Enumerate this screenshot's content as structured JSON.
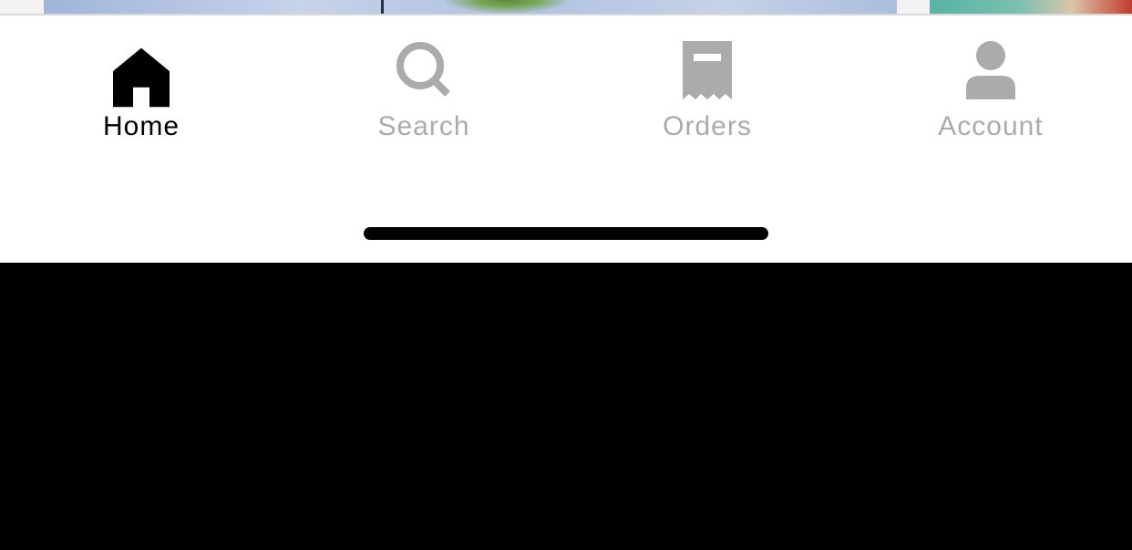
{
  "tab_bar": {
    "active": "home",
    "items": [
      {
        "id": "home",
        "label": "Home",
        "icon": "home-icon"
      },
      {
        "id": "search",
        "label": "Search",
        "icon": "search-icon"
      },
      {
        "id": "orders",
        "label": "Orders",
        "icon": "receipt-icon"
      },
      {
        "id": "account",
        "label": "Account",
        "icon": "person-icon"
      }
    ]
  },
  "colors": {
    "active": "#000000",
    "inactive": "#ababab",
    "bar_background": "#ffffff",
    "divider": "#d9d9d9"
  }
}
